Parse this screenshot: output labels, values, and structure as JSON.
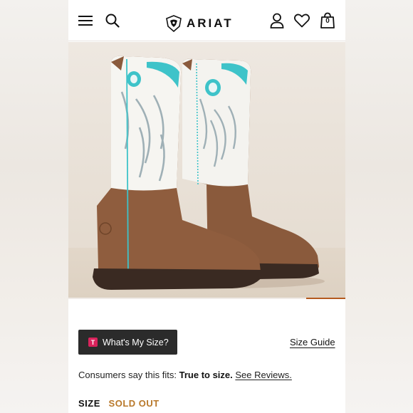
{
  "header": {
    "brand": "ARIAT",
    "bag_count": "0",
    "icons": [
      "menu-icon",
      "search-icon",
      "account-icon",
      "wishlist-heart-icon",
      "shopping-bag-icon"
    ]
  },
  "product": {
    "image_alt": "Ariat women's western boot, brown leather foot with white embroidered shaft and turquoise accents",
    "colors": {
      "shaft": "#f4f3ef",
      "embroidery": "#9fb0b6",
      "turquoise": "#3ec3c9",
      "leather": "#8a5a3c",
      "sole": "#3a2a22"
    }
  },
  "fit_tool": {
    "badge": "T",
    "button_label": "What's My Size?"
  },
  "size_guide_label": "Size Guide",
  "fit_summary": {
    "prefix": "Consumers say this fits:",
    "value": "True to size.",
    "link": "See Reviews."
  },
  "size": {
    "label": "SIZE",
    "status": "SOLD OUT"
  },
  "accent_colors": {
    "carousel_indicator": "#b55a1e",
    "sold_out": "#b8782a",
    "fit_badge": "#d9235c"
  }
}
